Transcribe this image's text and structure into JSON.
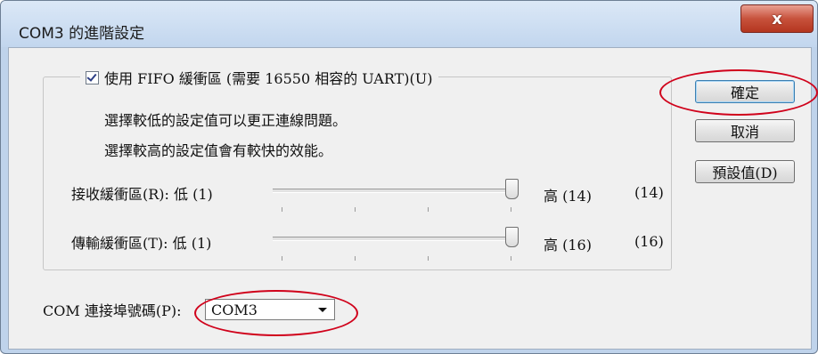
{
  "window": {
    "title": "COM3 的進階設定",
    "close_label": "x"
  },
  "fifo": {
    "checked": true,
    "label": "使用 FIFO 緩衝區 (需要 16550 相容的 UART)(U)"
  },
  "info": {
    "line1": "選擇較低的設定值可以更正連線問題。",
    "line2": "選擇較高的設定值會有較快的效能。"
  },
  "receive": {
    "label": "接收緩衝區(R): 低 (1)",
    "high_label": "高 (14)",
    "current": "(14)",
    "level_fraction": 1.0
  },
  "transmit": {
    "label": "傳輸緩衝區(T): 低 (1)",
    "high_label": "高 (16)",
    "current": "(16)",
    "level_fraction": 1.0
  },
  "buttons": {
    "ok": "確定",
    "cancel": "取消",
    "defaults": "預設值(D)"
  },
  "com_port": {
    "label": "COM 連接埠號碼(P):",
    "value": "COM3"
  },
  "annotation_color": "#d0021b"
}
